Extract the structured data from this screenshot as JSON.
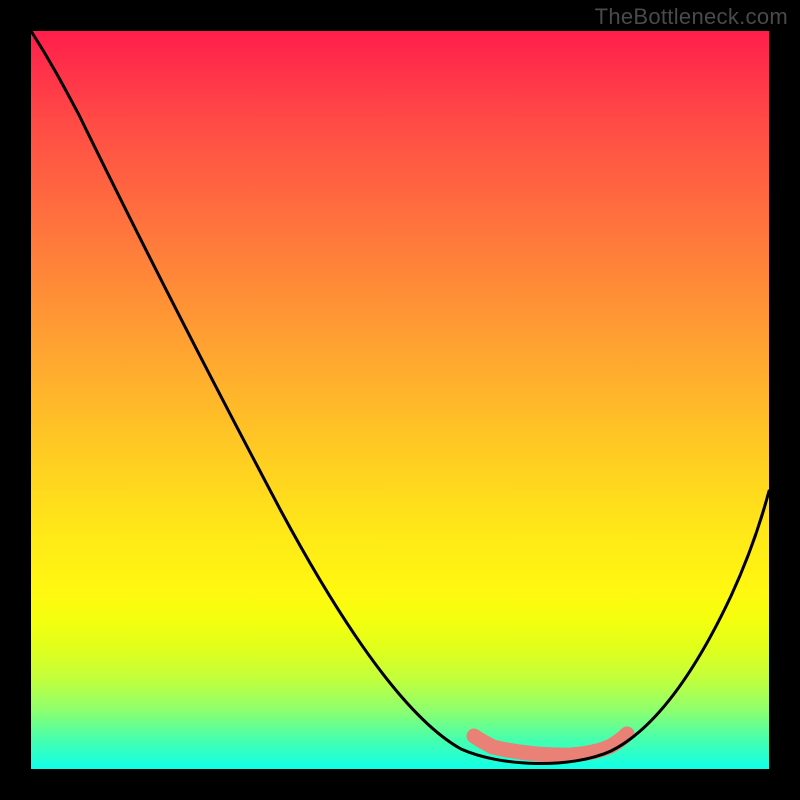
{
  "watermark": "TheBottleneck.com",
  "chart_data": {
    "type": "line",
    "title": "",
    "xlabel": "",
    "ylabel": "",
    "xlim": [
      0,
      100
    ],
    "ylim": [
      0,
      100
    ],
    "grid": false,
    "legend": false,
    "annotations": [],
    "series": [
      {
        "name": "bottleneck-curve",
        "x": [
          0,
          4,
          12,
          20,
          28,
          36,
          44,
          52,
          58,
          62,
          66,
          70,
          74,
          78,
          82,
          88,
          94,
          100
        ],
        "y": [
          100,
          96,
          86,
          74,
          62,
          50,
          38,
          26,
          15,
          8,
          3,
          1,
          1,
          3,
          8,
          18,
          30,
          42
        ],
        "color": "#000000"
      },
      {
        "name": "coral-band",
        "x": [
          60,
          64,
          68,
          72,
          76,
          80
        ],
        "y": [
          4.5,
          2.5,
          2,
          2,
          2.5,
          4.5
        ],
        "color": "#e98176"
      }
    ],
    "gradient_stops": [
      {
        "pos": 0,
        "color": "#ff1e4a"
      },
      {
        "pos": 20,
        "color": "#ff6141"
      },
      {
        "pos": 44,
        "color": "#ffa630"
      },
      {
        "pos": 68,
        "color": "#ffe818"
      },
      {
        "pos": 88,
        "color": "#c0ff3e"
      },
      {
        "pos": 100,
        "color": "#10ffe8"
      }
    ]
  }
}
